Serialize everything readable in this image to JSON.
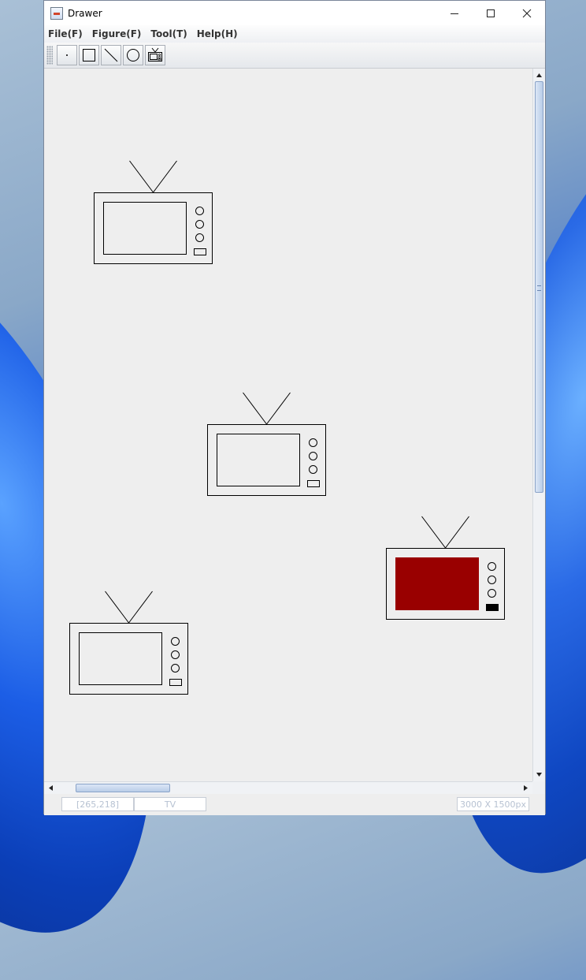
{
  "window": {
    "title": "Drawer"
  },
  "menu": [
    "File(F)",
    "Figure(F)",
    "Tool(T)",
    "Help(H)"
  ],
  "toolbar": [
    {
      "name": "dot-tool"
    },
    {
      "name": "rectangle-tool"
    },
    {
      "name": "line-tool"
    },
    {
      "name": "circle-tool"
    },
    {
      "name": "tv-tool"
    }
  ],
  "canvas": {
    "figures": [
      {
        "type": "tv",
        "screen_fill": "none"
      },
      {
        "type": "tv",
        "screen_fill": "none"
      },
      {
        "type": "tv",
        "screen_fill": "#990000",
        "selected": true
      },
      {
        "type": "tv",
        "screen_fill": "none"
      }
    ]
  },
  "status": {
    "coordinates": "[265,218]",
    "mode": "TV",
    "canvas_size": "3000 X 1500px"
  },
  "colors": {
    "selected_fill": "#990000",
    "canvas_bg": "#eeeeee"
  }
}
